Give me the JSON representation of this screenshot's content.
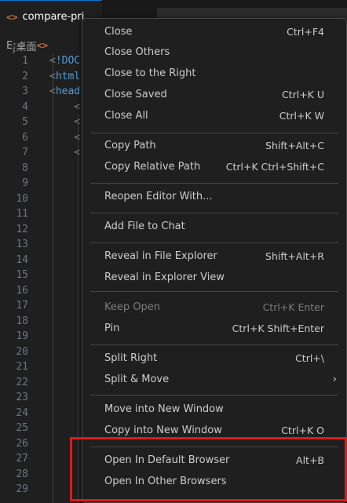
{
  "tab": {
    "icon": "html-icon",
    "icon_glyph": "<>",
    "title": "compare-pri"
  },
  "breadcrumb": {
    "drive": "E:",
    "folder": "桌面",
    "file_icon_glyph": "<>"
  },
  "editor": {
    "lines": [
      {
        "n": "1",
        "code": "<!DOC",
        "tag": true
      },
      {
        "n": "2",
        "code": "<html",
        "tag": true
      },
      {
        "n": "3",
        "code": "<head",
        "tag": true
      },
      {
        "n": "4",
        "code": "    <",
        "tag": false
      },
      {
        "n": "5",
        "code": "    <",
        "tag": false
      },
      {
        "n": "6",
        "code": "    <",
        "tag": false
      },
      {
        "n": "7",
        "code": "    <",
        "tag": false
      },
      {
        "n": "8",
        "code": "",
        "tag": false
      },
      {
        "n": "9",
        "code": "",
        "tag": false
      },
      {
        "n": "10",
        "code": "",
        "tag": false
      },
      {
        "n": "11",
        "code": "",
        "tag": false
      },
      {
        "n": "12",
        "code": "",
        "tag": false
      },
      {
        "n": "13",
        "code": "",
        "tag": false
      },
      {
        "n": "14",
        "code": "",
        "tag": false
      },
      {
        "n": "15",
        "code": "",
        "tag": false
      },
      {
        "n": "16",
        "code": "",
        "tag": false
      },
      {
        "n": "17",
        "code": "",
        "tag": false
      },
      {
        "n": "18",
        "code": "",
        "tag": false
      },
      {
        "n": "19",
        "code": "",
        "tag": false
      },
      {
        "n": "20",
        "code": "",
        "tag": false
      },
      {
        "n": "21",
        "code": "",
        "tag": false
      },
      {
        "n": "22",
        "code": "",
        "tag": false
      },
      {
        "n": "23",
        "code": "",
        "tag": false
      },
      {
        "n": "24",
        "code": "",
        "tag": false
      },
      {
        "n": "25",
        "code": "",
        "tag": false
      },
      {
        "n": "26",
        "code": "",
        "tag": false
      },
      {
        "n": "27",
        "code": "",
        "tag": false
      },
      {
        "n": "28",
        "code": "",
        "tag": false
      },
      {
        "n": "29",
        "code": "",
        "tag": false
      }
    ]
  },
  "menu": {
    "items": [
      {
        "label": "Close",
        "key": "Ctrl+F4"
      },
      {
        "label": "Close Others",
        "key": ""
      },
      {
        "label": "Close to the Right",
        "key": ""
      },
      {
        "label": "Close Saved",
        "key": "Ctrl+K U"
      },
      {
        "label": "Close All",
        "key": "Ctrl+K W"
      },
      {
        "label": "Copy Path",
        "key": "Shift+Alt+C"
      },
      {
        "label": "Copy Relative Path",
        "key": "Ctrl+K Ctrl+Shift+C"
      },
      {
        "label": "Reopen Editor With...",
        "key": ""
      },
      {
        "label": "Add File to Chat",
        "key": ""
      },
      {
        "label": "Reveal in File Explorer",
        "key": "Shift+Alt+R"
      },
      {
        "label": "Reveal in Explorer View",
        "key": ""
      },
      {
        "label": "Keep Open",
        "key": "Ctrl+K Enter",
        "disabled": true
      },
      {
        "label": "Pin",
        "key": "Ctrl+K Shift+Enter"
      },
      {
        "label": "Split Right",
        "key": "Ctrl+\\"
      },
      {
        "label": "Split & Move",
        "key": "",
        "submenu": true
      },
      {
        "label": "Move into New Window",
        "key": ""
      },
      {
        "label": "Copy into New Window",
        "key": "Ctrl+K O"
      },
      {
        "label": "Open In Default Browser",
        "key": "Alt+B"
      },
      {
        "label": "Open In Other Browsers",
        "key": ""
      }
    ]
  },
  "colors": {
    "accent": "#0078d4",
    "highlight_border": "#e0191b",
    "menu_bg": "#1f1f1f"
  }
}
